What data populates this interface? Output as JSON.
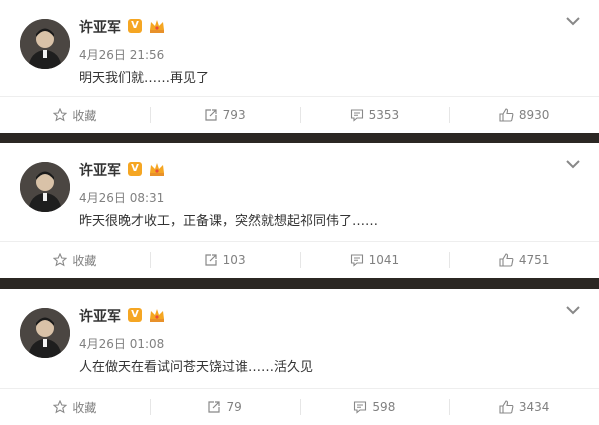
{
  "posts": [
    {
      "user": "许亚军",
      "vip_badge": "V",
      "time": "4月26日 21:56",
      "text": "明天我们就……再见了",
      "actions": {
        "favorite": "收藏",
        "repost": "793",
        "comment": "5353",
        "like": "8930"
      }
    },
    {
      "user": "许亚军",
      "vip_badge": "V",
      "time": "4月26日 08:31",
      "text": "昨天很晚才收工，正备课，突然就想起祁同伟了……",
      "actions": {
        "favorite": "收藏",
        "repost": "103",
        "comment": "1041",
        "like": "4751"
      }
    },
    {
      "user": "许亚军",
      "vip_badge": "V",
      "time": "4月26日 01:08",
      "text": "人在做天在看试问苍天饶过谁……活久见",
      "actions": {
        "favorite": "收藏",
        "repost": "79",
        "comment": "598",
        "like": "3434"
      }
    }
  ],
  "icons": {
    "favorite": "star-icon",
    "repost": "repost-icon",
    "comment": "comment-icon",
    "like": "thumbs-up-icon",
    "menu": "chevron-down-icon",
    "crown": "crown-icon"
  },
  "colors": {
    "background": "#2b2723",
    "card": "#ffffff",
    "name": "#333333",
    "meta": "#808080",
    "vip_badge": "#f5a623"
  }
}
